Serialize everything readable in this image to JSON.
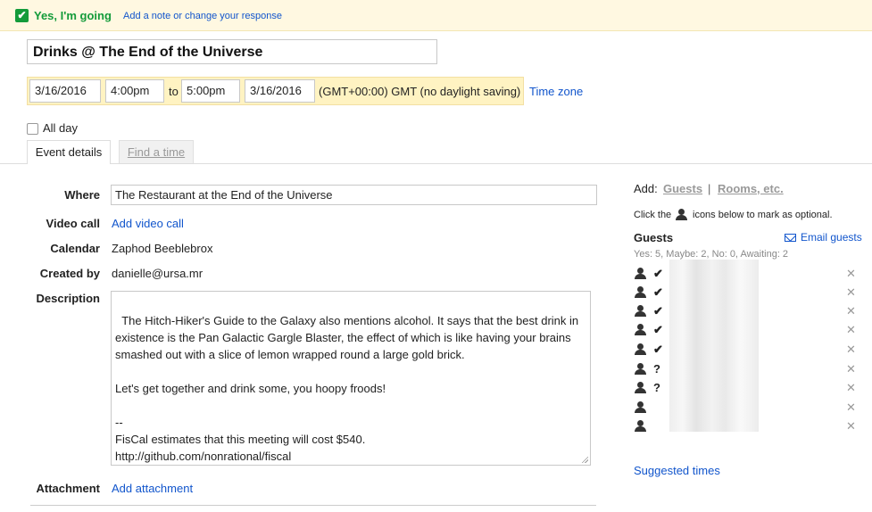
{
  "banner": {
    "status_label": "Yes, I'm going",
    "note_link": "Add a note or change your response"
  },
  "event": {
    "title": "Drinks @ The End of the Universe",
    "start_date": "3/16/2016",
    "start_time": "4:00pm",
    "to_label": "to",
    "end_time": "5:00pm",
    "end_date": "3/16/2016",
    "timezone": "(GMT+00:00) GMT (no daylight saving)",
    "timezone_link": "Time zone",
    "all_day_label": "All day"
  },
  "tabs": {
    "event_details": "Event details",
    "find_a_time": "Find a time"
  },
  "details": {
    "where_label": "Where",
    "where_value": "The Restaurant at the End of the Universe",
    "video_label": "Video call",
    "video_link": "Add video call",
    "calendar_label": "Calendar",
    "calendar_value": "Zaphod Beeblebrox",
    "created_label": "Created by",
    "created_value": "danielle@ursa.mr",
    "description_label": "Description",
    "description_value": "The Hitch-Hiker's Guide to the Galaxy also mentions alcohol. It says that the best drink in existence is the Pan Galactic Gargle Blaster, the effect of which is like having your brains smashed out with a slice of lemon wrapped round a large gold brick.\n\nLet's get together and drink some, you hoopy froods!\n\n--\nFisCal estimates that this meeting will cost $540.\nhttp://github.com/nonrational/fiscal",
    "attachment_label": "Attachment",
    "attachment_link": "Add attachment"
  },
  "sidebar": {
    "add_label": "Add:",
    "guests_link": "Guests",
    "separator": "|",
    "rooms_link": "Rooms, etc.",
    "optional_hint_pre": "Click the",
    "optional_hint_post": "icons below to mark as optional.",
    "guests_heading": "Guests",
    "email_guests": "Email guests",
    "rsvp_summary": "Yes: 5, Maybe: 2, No: 0, Awaiting: 2",
    "guests": [
      {
        "status": "✔"
      },
      {
        "status": "✔"
      },
      {
        "status": "✔"
      },
      {
        "status": "✔"
      },
      {
        "status": "✔"
      },
      {
        "status": "?"
      },
      {
        "status": "?"
      },
      {
        "status": ""
      },
      {
        "status": ""
      }
    ],
    "remove_glyph": "✕",
    "suggested_times": "Suggested times"
  },
  "icons": {
    "check": "✔"
  },
  "colors": {
    "going_green": "#139b3a",
    "banner_bg": "#fff8e1",
    "date_strip_bg": "#fff3c2",
    "link_blue": "#1155cc"
  }
}
